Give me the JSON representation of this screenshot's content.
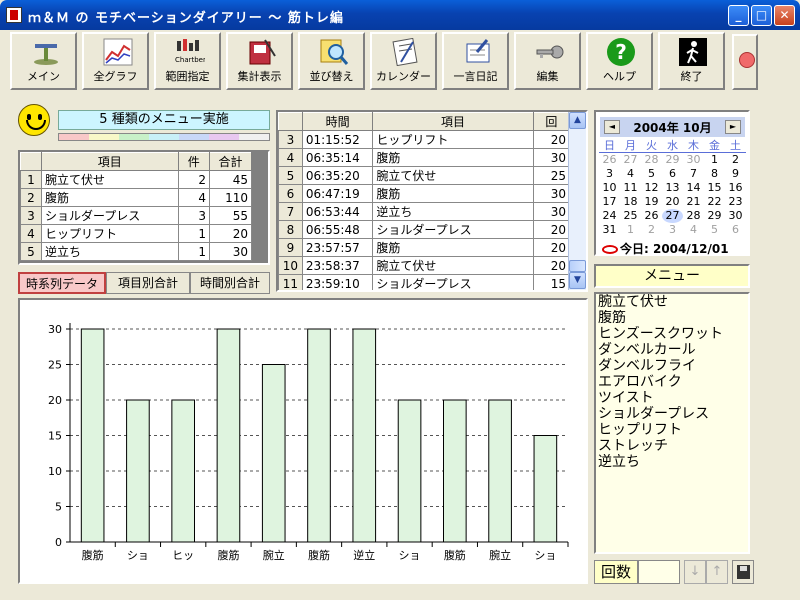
{
  "window": {
    "title": "ｍ＆Ｍ の モチベーションダイアリー ～ 筋トレ編",
    "min": "_",
    "max": "□",
    "close": "✕"
  },
  "toolbar": [
    {
      "icon": "scale-icon",
      "label": "メイン"
    },
    {
      "icon": "graph-icon",
      "label": "全グラフ"
    },
    {
      "icon": "chart-range-icon",
      "label": "範囲指定",
      "badge": "Chartbem"
    },
    {
      "icon": "sum-book-icon",
      "label": "集計表示"
    },
    {
      "icon": "magnifier-icon",
      "label": "並び替え"
    },
    {
      "icon": "calendar-pad-icon",
      "label": "カレンダー"
    },
    {
      "icon": "diary-pen-icon",
      "label": "一言日記"
    },
    {
      "icon": "key-icon",
      "label": "編集"
    },
    {
      "icon": "help-icon",
      "label": "ヘルプ",
      "glyph": "?"
    },
    {
      "icon": "exit-icon",
      "label": "終了"
    }
  ],
  "summary": {
    "text": "5 種類のメニュー実施"
  },
  "colors": {
    "strip": [
      "#f8c8c8",
      "#f8f8c8",
      "#c8f0c8",
      "#c8f0f8",
      "#c8d8f8",
      "#e8c8f0",
      "#f0f0f0"
    ],
    "bar": "#dff4df",
    "barStroke": "#000"
  },
  "sumtable": {
    "headers": [
      "",
      "項目",
      "件",
      "合計"
    ],
    "rows": [
      [
        "1",
        "腕立て伏せ",
        "2",
        "45"
      ],
      [
        "2",
        "腹筋",
        "4",
        "110"
      ],
      [
        "3",
        "ショルダープレス",
        "3",
        "55"
      ],
      [
        "4",
        "ヒップリフト",
        "1",
        "20"
      ],
      [
        "5",
        "逆立ち",
        "1",
        "30"
      ]
    ]
  },
  "tabs": [
    "時系列データ",
    "項目別合計",
    "時間別合計"
  ],
  "log": {
    "headers": [
      "",
      "時間",
      "項目",
      "回"
    ],
    "rows": [
      [
        "3",
        "01:15:52",
        "ヒップリフト",
        "20"
      ],
      [
        "4",
        "06:35:14",
        "腹筋",
        "30"
      ],
      [
        "5",
        "06:35:20",
        "腕立て伏せ",
        "25"
      ],
      [
        "6",
        "06:47:19",
        "腹筋",
        "30"
      ],
      [
        "7",
        "06:53:44",
        "逆立ち",
        "30"
      ],
      [
        "8",
        "06:55:48",
        "ショルダープレス",
        "20"
      ],
      [
        "9",
        "23:57:57",
        "腹筋",
        "20"
      ],
      [
        "10",
        "23:58:37",
        "腕立て伏せ",
        "20"
      ],
      [
        "11",
        "23:59:10",
        "ショルダープレス",
        "15"
      ]
    ]
  },
  "calendar": {
    "title": "2004年 10月",
    "prev": "◄",
    "next": "►",
    "dow": [
      "日",
      "月",
      "火",
      "水",
      "木",
      "金",
      "土"
    ],
    "weeks": [
      [
        "26",
        "27",
        "28",
        "29",
        "30",
        "1",
        "2"
      ],
      [
        "3",
        "4",
        "5",
        "6",
        "7",
        "8",
        "9"
      ],
      [
        "10",
        "11",
        "12",
        "13",
        "14",
        "15",
        "16"
      ],
      [
        "17",
        "18",
        "19",
        "20",
        "21",
        "22",
        "23"
      ],
      [
        "24",
        "25",
        "26",
        "27",
        "28",
        "29",
        "30"
      ],
      [
        "31",
        "1",
        "2",
        "3",
        "4",
        "5",
        "6"
      ]
    ],
    "today_label": "今日: 2004/12/01"
  },
  "menu": {
    "title": "メニュー",
    "items": [
      "腕立て伏せ",
      "腹筋",
      "ヒンズースクワット",
      "ダンベルカール",
      "ダンベルフライ",
      "エアロバイク",
      "ツイスト",
      "ショルダープレス",
      "ヒップリフト",
      "ストレッチ",
      "逆立ち"
    ]
  },
  "counter": {
    "label": "回数",
    "down": "↓",
    "up": "↑"
  },
  "chart_data": {
    "type": "bar",
    "categories": [
      "腹筋",
      "ショ",
      "ヒッ",
      "腹筋",
      "腕立",
      "腹筋",
      "逆立",
      "ショ",
      "腹筋",
      "腕立",
      "ショ"
    ],
    "values": [
      30,
      20,
      20,
      30,
      25,
      30,
      30,
      20,
      20,
      20,
      15
    ],
    "yticks": [
      "0",
      "5",
      "10",
      "15",
      "20",
      "25",
      "30"
    ],
    "ylim": [
      0,
      30
    ],
    "grid": true
  }
}
